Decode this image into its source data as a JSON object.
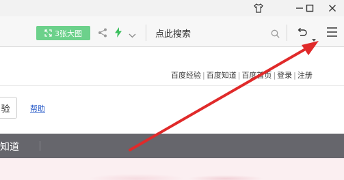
{
  "toolbar": {
    "image_button": "3张大图",
    "search_placeholder": "点此搜索"
  },
  "page": {
    "top_links": [
      "百度经验",
      "百度知道",
      "百度首页",
      "登录",
      "注册"
    ],
    "left_button_label": "验",
    "help_link": "帮助",
    "darkbar_text": "知道"
  },
  "annotation": {
    "arrow_color": "#e02a2a"
  }
}
